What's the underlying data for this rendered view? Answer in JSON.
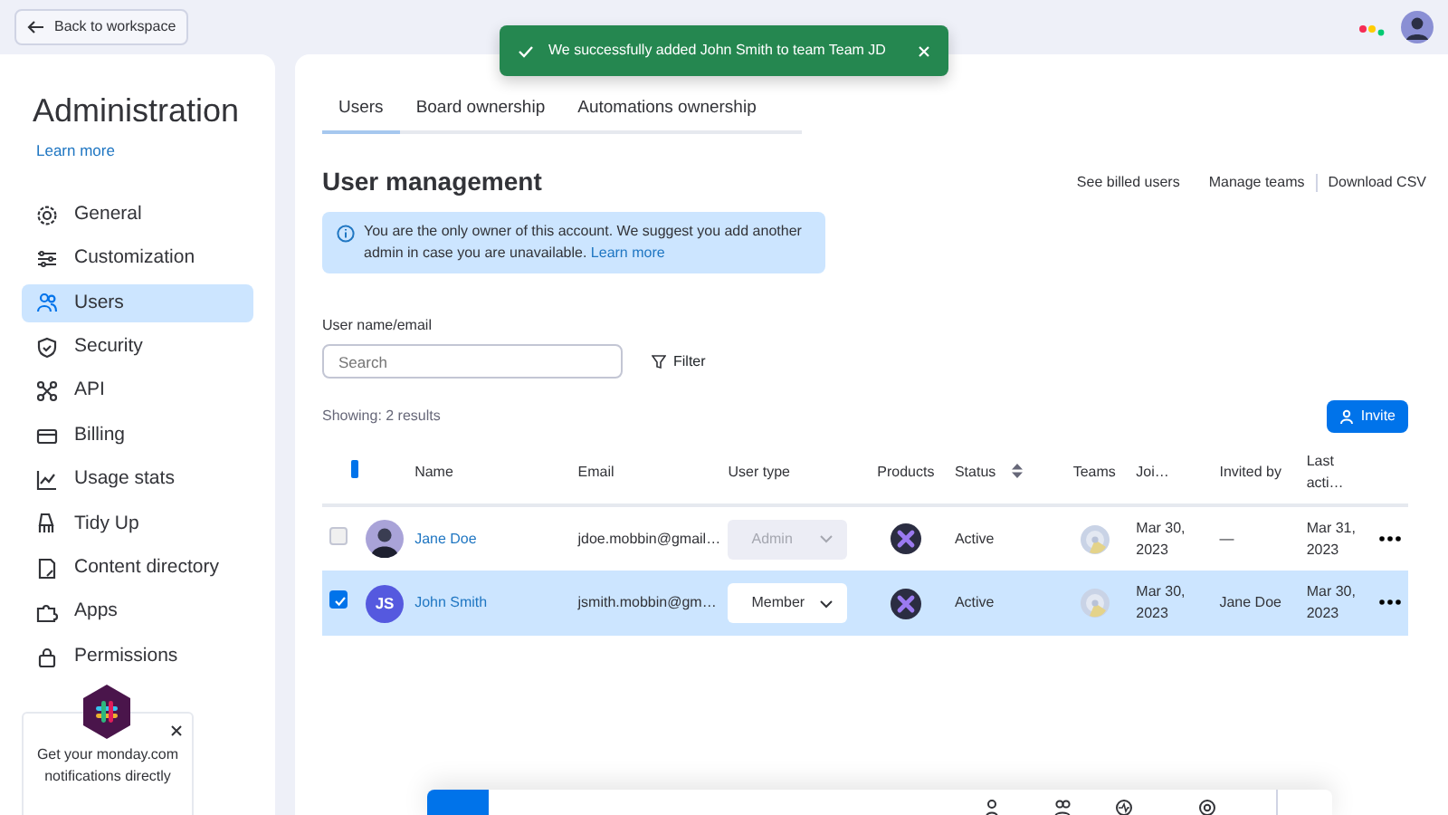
{
  "top_bar": {
    "back_button": "Back to workspace"
  },
  "toast": {
    "message": "We successfully added John Smith to team Team JD"
  },
  "sidebar": {
    "title": "Administration",
    "learn_more": "Learn more",
    "items": [
      {
        "label": "General",
        "selected": false
      },
      {
        "label": "Customization",
        "selected": false
      },
      {
        "label": "Users",
        "selected": true
      },
      {
        "label": "Security",
        "selected": false
      },
      {
        "label": "API",
        "selected": false
      },
      {
        "label": "Billing",
        "selected": false
      },
      {
        "label": "Usage stats",
        "selected": false
      },
      {
        "label": "Tidy Up",
        "selected": false
      },
      {
        "label": "Content directory",
        "selected": false
      },
      {
        "label": "Apps",
        "selected": false
      },
      {
        "label": "Permissions",
        "selected": false
      }
    ]
  },
  "slack_popup": {
    "text": "Get your monday.com notifications directly"
  },
  "tabs": [
    {
      "label": "Users",
      "selected": true
    },
    {
      "label": "Board ownership",
      "selected": false
    },
    {
      "label": "Automations ownership",
      "selected": false
    }
  ],
  "page_title": "User management",
  "header_links": [
    "See billed users",
    "Manage teams",
    "Download CSV"
  ],
  "info_banner": {
    "text": "You are the only owner of this account. We suggest you add another admin in case you are unavailable.",
    "link": "Learn more"
  },
  "search": {
    "label": "User name/email",
    "placeholder": "Search"
  },
  "filter_button": "Filter",
  "results_count": "Showing: 2 results",
  "invite_button": "Invite",
  "table": {
    "select_all_partial": true,
    "columns": [
      "Name",
      "Email",
      "User type",
      "Products",
      "Status",
      "Teams",
      "Joi…",
      "Invited by",
      "Last acti…"
    ],
    "rows": [
      {
        "selected": false,
        "avatar": {
          "kind": "photo"
        },
        "name": "Jane Doe",
        "email": "jdoe.mobbin@gmail…",
        "user_type": "Admin",
        "user_type_disabled": true,
        "status": "Active",
        "joined": "Mar 30, 2023",
        "invited_by": "—",
        "last_active": "Mar 31, 2023"
      },
      {
        "selected": true,
        "avatar": {
          "kind": "initials",
          "initials": "JS"
        },
        "name": "John Smith",
        "email": "jsmith.mobbin@gm…",
        "user_type": "Member",
        "user_type_disabled": false,
        "status": "Active",
        "joined": "Mar 30, 2023",
        "invited_by": "Jane Doe",
        "last_active": "Mar 30, 2023"
      }
    ]
  }
}
